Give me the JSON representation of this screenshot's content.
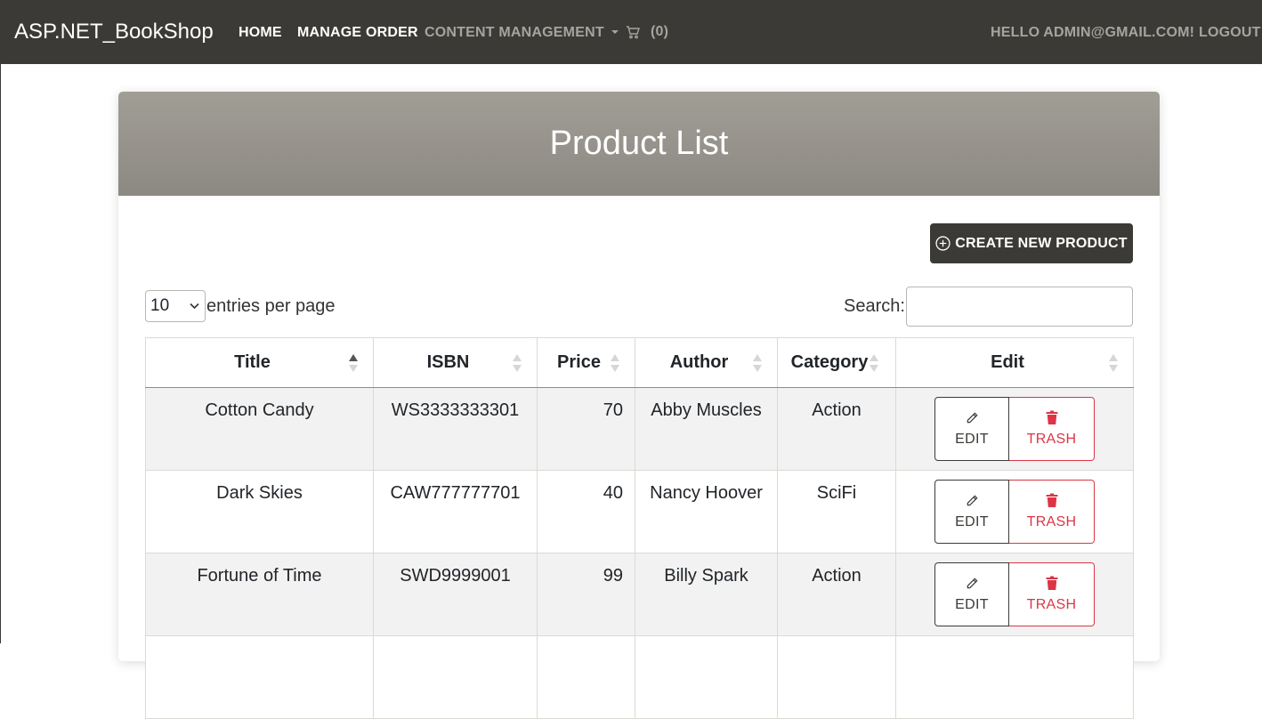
{
  "navbar": {
    "brand": "ASP.NET_BookShop",
    "home": "HOME",
    "manage_order": "MANAGE ORDER",
    "content_management": "CONTENT MANAGEMENT",
    "cart_count": "(0)",
    "hello": "HELLO ADMIN@GMAIL.COM!",
    "logout": "LOGOUT"
  },
  "page": {
    "title": "Product List",
    "create_button": "CREATE NEW PRODUCT"
  },
  "controls": {
    "entries_value": "10",
    "entries_label": "entries per page",
    "search_label": "Search:",
    "search_value": ""
  },
  "table": {
    "headers": [
      "Title",
      "ISBN",
      "Price",
      "Author",
      "Category",
      "Edit"
    ],
    "sorted_column": "Title",
    "rows": [
      {
        "title": "Cotton Candy",
        "isbn": "WS3333333301",
        "price": "70",
        "author": "Abby Muscles",
        "category": "Action",
        "edit": "EDIT",
        "trash": "TRASH"
      },
      {
        "title": "Dark Skies",
        "isbn": "CAW777777701",
        "price": "40",
        "author": "Nancy Hoover",
        "category": "SciFi",
        "edit": "EDIT",
        "trash": "TRASH"
      },
      {
        "title": "Fortune of Time",
        "isbn": "SWD9999001",
        "price": "99",
        "author": "Billy Spark",
        "category": "Action",
        "edit": "EDIT",
        "trash": "TRASH"
      }
    ]
  },
  "colors": {
    "navbar_bg": "#3b3a36",
    "header_gradient_top": "#a19e96",
    "header_gradient_bottom": "#8c8982",
    "danger": "#dc3545"
  },
  "icons": {
    "cart": "cart-icon",
    "create": "plus-circle-icon",
    "edit": "pencil-icon",
    "trash": "trash-icon",
    "sort": "sort-arrows-icon",
    "dropdown": "chevron-down-icon"
  }
}
